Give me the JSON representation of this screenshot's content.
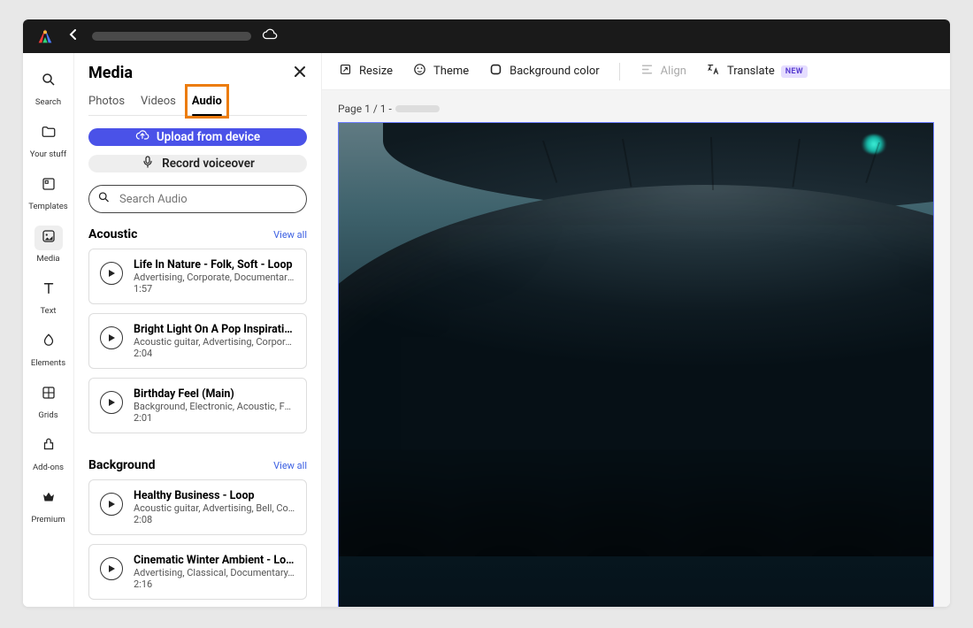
{
  "rail": {
    "items": [
      {
        "id": "search",
        "label": "Search"
      },
      {
        "id": "your-stuff",
        "label": "Your stuff"
      },
      {
        "id": "templates",
        "label": "Templates"
      },
      {
        "id": "media",
        "label": "Media"
      },
      {
        "id": "text",
        "label": "Text"
      },
      {
        "id": "elements",
        "label": "Elements"
      },
      {
        "id": "grids",
        "label": "Grids"
      },
      {
        "id": "add-ons",
        "label": "Add-ons"
      },
      {
        "id": "premium",
        "label": "Premium"
      }
    ]
  },
  "panel": {
    "title": "Media",
    "tabs": {
      "photos": "Photos",
      "videos": "Videos",
      "audio": "Audio"
    },
    "active_tab": "audio",
    "upload_label": "Upload from device",
    "record_label": "Record voiceover",
    "search_placeholder": "Search Audio",
    "view_all": "View all",
    "sections": [
      {
        "title": "Acoustic",
        "tracks": [
          {
            "title": "Life In Nature - Folk, Soft - Loop",
            "tags": "Advertising, Corporate, Documentary, D…",
            "duration": "1:57"
          },
          {
            "title": "Bright Light On A Pop Inspiratio…",
            "tags": "Acoustic guitar, Advertising, Corporate, …",
            "duration": "2:04"
          },
          {
            "title": "Birthday Feel (Main)",
            "tags": "Background, Electronic, Acoustic, Folk, …",
            "duration": "2:01"
          }
        ]
      },
      {
        "title": "Background",
        "tracks": [
          {
            "title": "Healthy Business - Loop",
            "tags": "Acoustic guitar, Advertising, Bell, Corpor…",
            "duration": "2:08"
          },
          {
            "title": "Cinematic Winter Ambient - Loop",
            "tags": "Advertising, Classical, Documentary, Dr…",
            "duration": "2:16"
          }
        ]
      }
    ]
  },
  "toolbar": {
    "resize": "Resize",
    "theme": "Theme",
    "background": "Background color",
    "align": "Align",
    "translate": "Translate",
    "new_badge": "NEW"
  },
  "stage": {
    "page_label": "Page 1 / 1 -"
  }
}
